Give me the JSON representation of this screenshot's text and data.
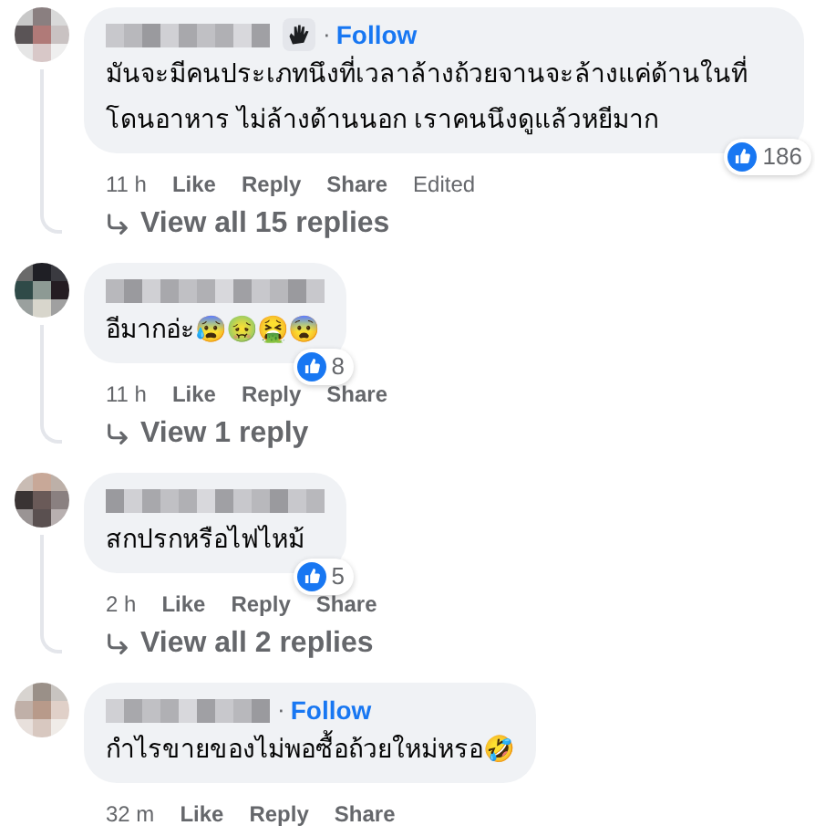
{
  "comments": [
    {
      "separator": "·",
      "follow": "Follow",
      "badge": true,
      "text": "มันจะมีคนประเภทนึงที่เวลาล้างถ้วยจานจะล้างแค่ด้านในที่โดนอาหาร ไม่ล้างด้านนอก เราคนนึงดูแล้วหยีมาก",
      "reaction_count": "186",
      "time": "11 h",
      "actions": [
        "Like",
        "Reply",
        "Share"
      ],
      "edited": "Edited",
      "view_replies": "View all 15 replies"
    },
    {
      "text": "อีมากอ่ะ😰🤢🤮😨",
      "reaction_count": "8",
      "time": "11 h",
      "actions": [
        "Like",
        "Reply",
        "Share"
      ],
      "view_replies": "View 1 reply"
    },
    {
      "text": "สกปรกหรือไฟไหม้",
      "reaction_count": "5",
      "time": "2 h",
      "actions": [
        "Like",
        "Reply",
        "Share"
      ],
      "view_replies": "View all 2 replies"
    },
    {
      "separator": "·",
      "follow": "Follow",
      "badge": false,
      "text": "กำไรขายของไม่พอซื้อถ้วยใหม่หรอ🤣",
      "time": "32 m",
      "actions": [
        "Like",
        "Reply",
        "Share"
      ]
    }
  ]
}
